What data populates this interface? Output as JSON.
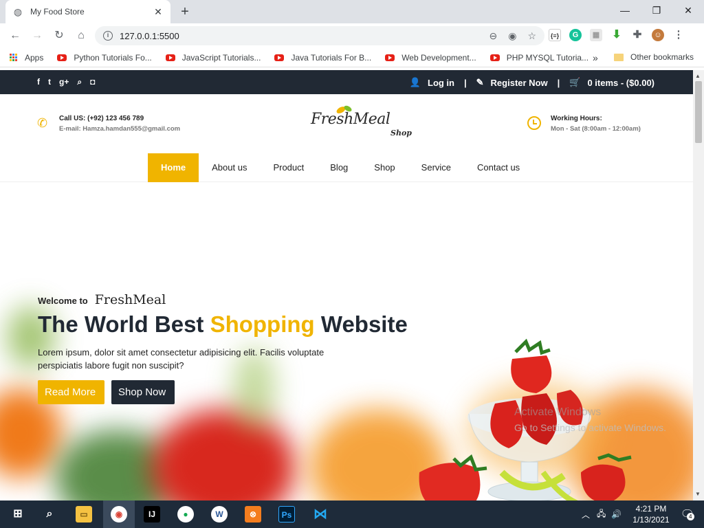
{
  "browser": {
    "tab_title": "My Food Store",
    "url": "127.0.0.1:5500",
    "bookmarks": [
      {
        "label": "Apps",
        "type": "apps"
      },
      {
        "label": "Python Tutorials Fo...",
        "type": "youtube"
      },
      {
        "label": "JavaScript Tutorials...",
        "type": "youtube"
      },
      {
        "label": "Java Tutorials For B...",
        "type": "youtube"
      },
      {
        "label": "Web Development...",
        "type": "youtube"
      },
      {
        "label": "PHP MYSQL Tutoria...",
        "type": "youtube"
      }
    ],
    "more": "»",
    "other_bookmarks": "Other bookmarks"
  },
  "topbar": {
    "social": [
      "f",
      "t",
      "g+",
      "search",
      "instagram"
    ],
    "login": "Log in",
    "register": "Register Now",
    "cart": "0 items - ($0.00)",
    "separator": "|"
  },
  "header": {
    "call_title": "Call US: (+92) 123 456 789",
    "email": "E-mail: Hamza.hamdan555@gmail.com",
    "logo_name": "FreshMeal",
    "logo_sub": "Shop",
    "hours_title": "Working Hours:",
    "hours_value": "Mon - Sat (8:00am - 12:00am)"
  },
  "nav": {
    "items": [
      "Home",
      "About us",
      "Product",
      "Blog",
      "Shop",
      "Service",
      "Contact us"
    ],
    "active": "Home"
  },
  "hero": {
    "welcome": "Welcome to",
    "welcome_brand": "FreshMeal",
    "headline_1": "The World Best ",
    "headline_2": "Shopping",
    "headline_3": " Website",
    "lead": "Lorem ipsum, dolor sit amet consectetur adipisicing elit. Facilis voluptate perspiciatis labore fugit non suscipit?",
    "btn_read": "Read More",
    "btn_shop": "Shop Now"
  },
  "watermark": {
    "line1": "Activate Windows",
    "line2": "Go to Settings to activate Windows."
  },
  "taskbar": {
    "time": "4:21 PM",
    "date": "1/13/2021",
    "notifications": "4"
  },
  "colors": {
    "accent": "#f0b400",
    "dark": "#212934"
  }
}
